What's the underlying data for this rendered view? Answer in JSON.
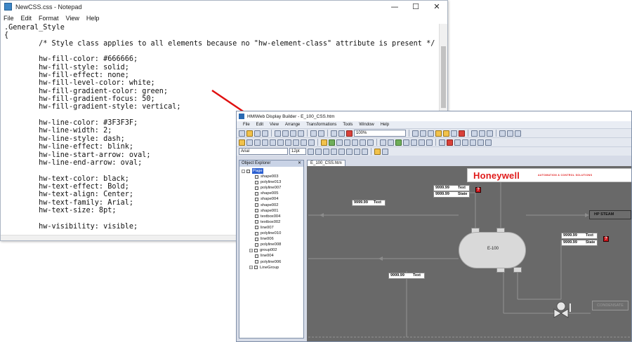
{
  "notepad": {
    "title": "NewCSS.css - Notepad",
    "window_controls": [
      "—",
      "☐",
      "✕"
    ],
    "menu": [
      "File",
      "Edit",
      "Format",
      "View",
      "Help"
    ],
    "lines": [
      ".General_Style",
      "{",
      "        /* Style class applies to all elements because no \"hw-element-class\" attribute is present */",
      "",
      "        hw-fill-color: #666666;",
      "        hw-fill-style: solid;",
      "        hw-fill-effect: none;",
      "        hw-fill-level-color: white;",
      "        hw-fill-gradient-color: green;",
      "        hw-fill-gradient-focus: 50;",
      "        hw-fill-gradient-style: vertical;",
      "",
      "        hw-line-color: #3F3F3F;",
      "        hw-line-width: 2;",
      "        hw-line-style: dash;",
      "        hw-line-effect: blink;",
      "        hw-line-start-arrow: oval;",
      "        hw-line-end-arrow: oval;",
      "",
      "        hw-text-color: black;",
      "        hw-text-effect: Bold;",
      "        hw-text-align: Center;",
      "        hw-text-family: Arial;",
      "        hw-text-size: 8pt;",
      "",
      "        hw-visibility: visible;"
    ]
  },
  "builder": {
    "title": "HMIWeb Display Builder - E_100_CSS.htm",
    "menu": [
      "File",
      "Edit",
      "View",
      "Arrange",
      "Transformations",
      "Tools",
      "Window",
      "Help"
    ],
    "zoom": "100%",
    "font_name": "Arial",
    "font_size": "12pt",
    "object_explorer_title": "Object Explorer",
    "object_explorer_close": "✕",
    "tree_root": "Page",
    "tree_items": [
      "shape003",
      "polyline013",
      "polyline007",
      "shape005",
      "shape004",
      "shape002",
      "shape001",
      "textbox004",
      "textbox002",
      "line007",
      "polyline010",
      "line006",
      "polyline008",
      "group002",
      "line004",
      "polyline006",
      "LineGroup"
    ],
    "tab_label": "E_100_CSS.htm",
    "canvas": {
      "logo": "Honeywell",
      "tagline": "AUTOMATION & CONTROL SOLUTIONS",
      "tank_label": "E-100",
      "hp_steam": "HP STEAM",
      "condensate": "CONDENSATE",
      "value_text": "9999.99",
      "text_label": "Text",
      "state_label": "State",
      "alarm_glyph": "?"
    },
    "colors": {
      "canvas_bg": "#696969",
      "brand_red": "#e01a1a",
      "alarm_red": "#c8141a",
      "arrow_red": "#e01010"
    }
  }
}
